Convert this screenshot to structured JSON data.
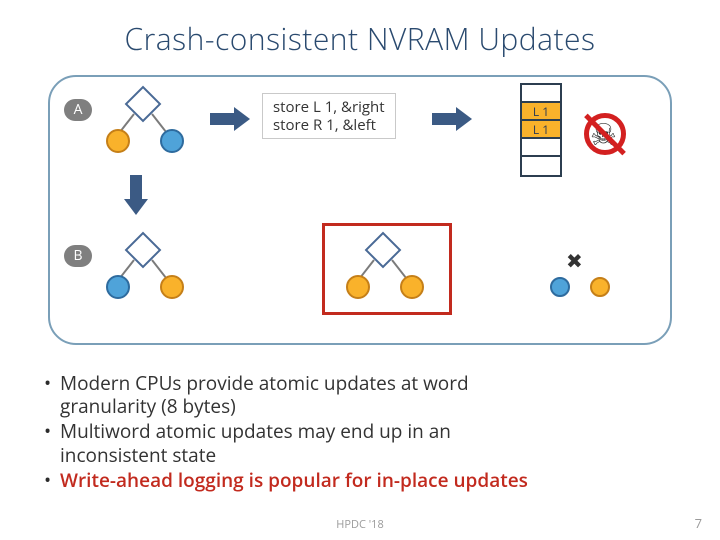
{
  "title": "Crash-consistent NVRAM Updates",
  "state": {
    "a": "A",
    "b": "B"
  },
  "code": {
    "line1": "store L 1, &right",
    "line2": "store R 1, &left"
  },
  "cache": {
    "rows": [
      "",
      "L 1",
      "L 1",
      "",
      ""
    ]
  },
  "bullets": {
    "b1a": "Modern CPUs provide atomic updates at word",
    "b1b": "granularity (8 bytes)",
    "b2a": "Multiword atomic updates may end up in an",
    "b2b": "inconsistent state",
    "b3": "Write-ahead logging is popular for in-place updates"
  },
  "footer": {
    "conf": "HPDC '18",
    "page": "7"
  },
  "icons": {
    "skull": "☠",
    "cross": "✖"
  }
}
